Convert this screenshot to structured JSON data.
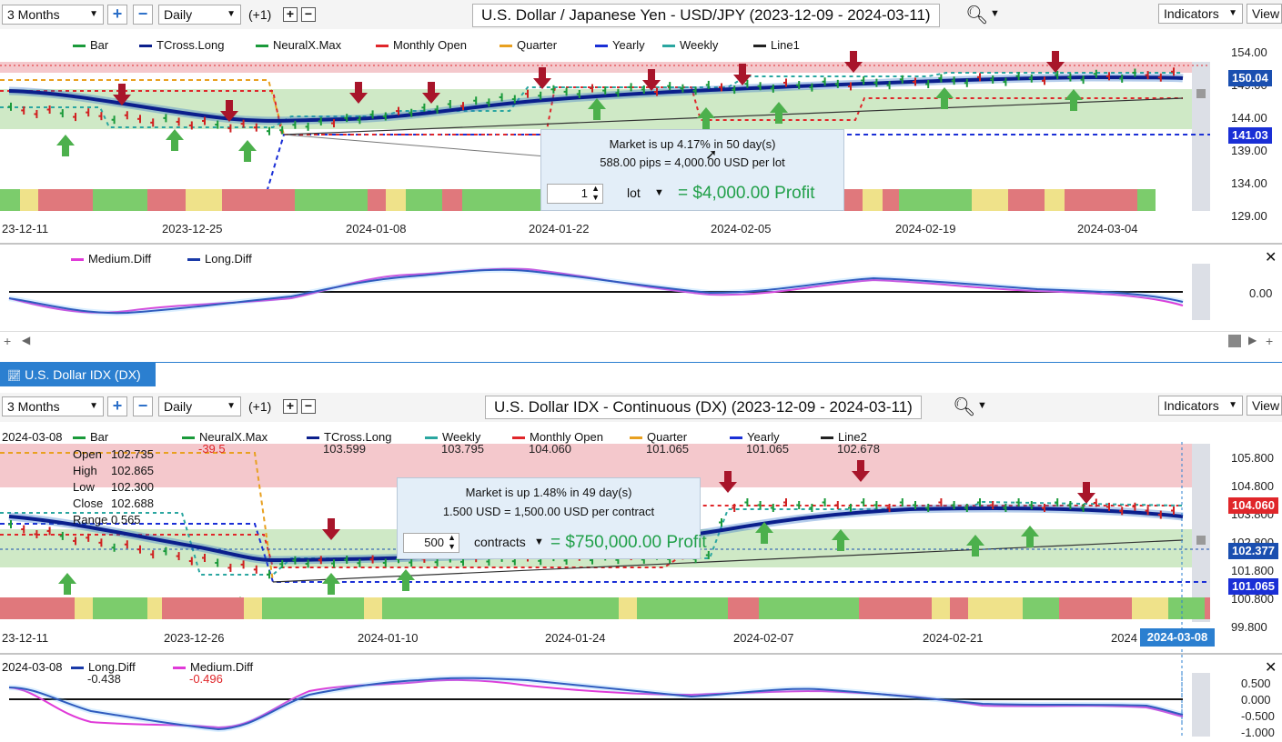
{
  "panel1": {
    "toolbar": {
      "range": "3 Months",
      "interval": "Daily",
      "offset": "(+1)",
      "title": "U.S. Dollar / Japanese Yen - USD/JPY (2023-12-09 - 2024-03-11)",
      "indicators": "Indicators",
      "view": "View"
    },
    "legend": [
      {
        "label": "Bar",
        "color": "#1a9a3a"
      },
      {
        "label": "TCross.Long",
        "color": "#0b1f8c"
      },
      {
        "label": "NeuralX.Max",
        "color": "#1a9a3a"
      },
      {
        "label": "Monthly Open",
        "color": "#e0262a"
      },
      {
        "label": "Quarter",
        "color": "#e8a020"
      },
      {
        "label": "Yearly",
        "color": "#1a2fd6"
      },
      {
        "label": "Weekly",
        "color": "#2aa6a0"
      },
      {
        "label": "Line1",
        "color": "#222222"
      }
    ],
    "price_ticks": [
      "154.00",
      "149.00",
      "144.00",
      "139.00",
      "134.00",
      "129.00"
    ],
    "price_tags": [
      {
        "value": "150.04",
        "color": "#1a4fb0"
      },
      {
        "value": "141.03",
        "color": "#1a2fd6"
      }
    ],
    "date_ticks": [
      "23-12-11",
      "2023-12-25",
      "2024-01-08",
      "2024-01-22",
      "2024-02-05",
      "2024-02-19",
      "2024-03-04"
    ],
    "tooltip": {
      "line1": "Market is up 4.17% in 50 day(s)",
      "line2": "588.00 pips = 4,000.00 USD per lot",
      "qty": "1",
      "unit": "lot",
      "profit": "= $4,000.00 Profit"
    },
    "sub": {
      "legend": [
        {
          "label": "Medium.Diff",
          "color": "#e03ad8"
        },
        {
          "label": "Long.Diff",
          "color": "#1a3aa8"
        }
      ],
      "ticks": [
        "0.00"
      ]
    }
  },
  "tab": {
    "label": "U.S. Dollar IDX (DX)"
  },
  "panel2": {
    "toolbar": {
      "range": "3 Months",
      "interval": "Daily",
      "offset": "(+1)",
      "title": "U.S. Dollar IDX - Continuous (DX) (2023-12-09 - 2024-03-11)",
      "indicators": "Indicators",
      "view": "View"
    },
    "date_label": "2024-03-08",
    "legend": [
      {
        "label": "Bar",
        "value": "",
        "color": "#1a9a3a"
      },
      {
        "label": "NeuralX.Max",
        "value": "-39.5",
        "color": "#1a9a3a"
      },
      {
        "label": "TCross.Long",
        "value": "103.599",
        "color": "#0b1f8c"
      },
      {
        "label": "Weekly",
        "value": "103.795",
        "color": "#2aa6a0"
      },
      {
        "label": "Monthly Open",
        "value": "104.060",
        "color": "#e0262a"
      },
      {
        "label": "Quarter",
        "value": "101.065",
        "color": "#e8a020"
      },
      {
        "label": "Yearly",
        "value": "101.065",
        "color": "#1a2fd6"
      },
      {
        "label": "Line2",
        "value": "102.678",
        "color": "#222222"
      }
    ],
    "ohlc": [
      {
        "label": "Open",
        "value": "102.735"
      },
      {
        "label": "High",
        "value": "102.865"
      },
      {
        "label": "Low",
        "value": "102.300"
      },
      {
        "label": "Close",
        "value": "102.688"
      },
      {
        "label": "Range",
        "value": "0.565"
      }
    ],
    "price_ticks": [
      "105.800",
      "104.800",
      "103.800",
      "102.800",
      "101.800",
      "100.800",
      "99.800"
    ],
    "price_tags": [
      {
        "value": "104.060",
        "color": "#e0262a"
      },
      {
        "value": "102.377",
        "color": "#1a4fb0"
      },
      {
        "value": "101.065",
        "color": "#1a2fd6"
      }
    ],
    "date_ticks": [
      "23-12-11",
      "2023-12-26",
      "2024-01-10",
      "2024-01-24",
      "2024-02-07",
      "2024-02-21",
      "2024"
    ],
    "cursor_date": "2024-03-08",
    "tooltip": {
      "line1": "Market is up 1.48% in 49 day(s)",
      "line2": "1.500 USD = 1,500.00 USD per contract",
      "qty": "500",
      "unit": "contracts",
      "profit": "= $750,000.00 Profit"
    },
    "sub": {
      "date_label": "2024-03-08",
      "legend": [
        {
          "label": "Long.Diff",
          "value": "-0.438",
          "color": "#1a3aa8"
        },
        {
          "label": "Medium.Diff",
          "value": "-0.496",
          "color": "#e03ad8"
        }
      ],
      "ticks": [
        "0.500",
        "0.000",
        "-0.500",
        "-1.000"
      ]
    }
  }
}
